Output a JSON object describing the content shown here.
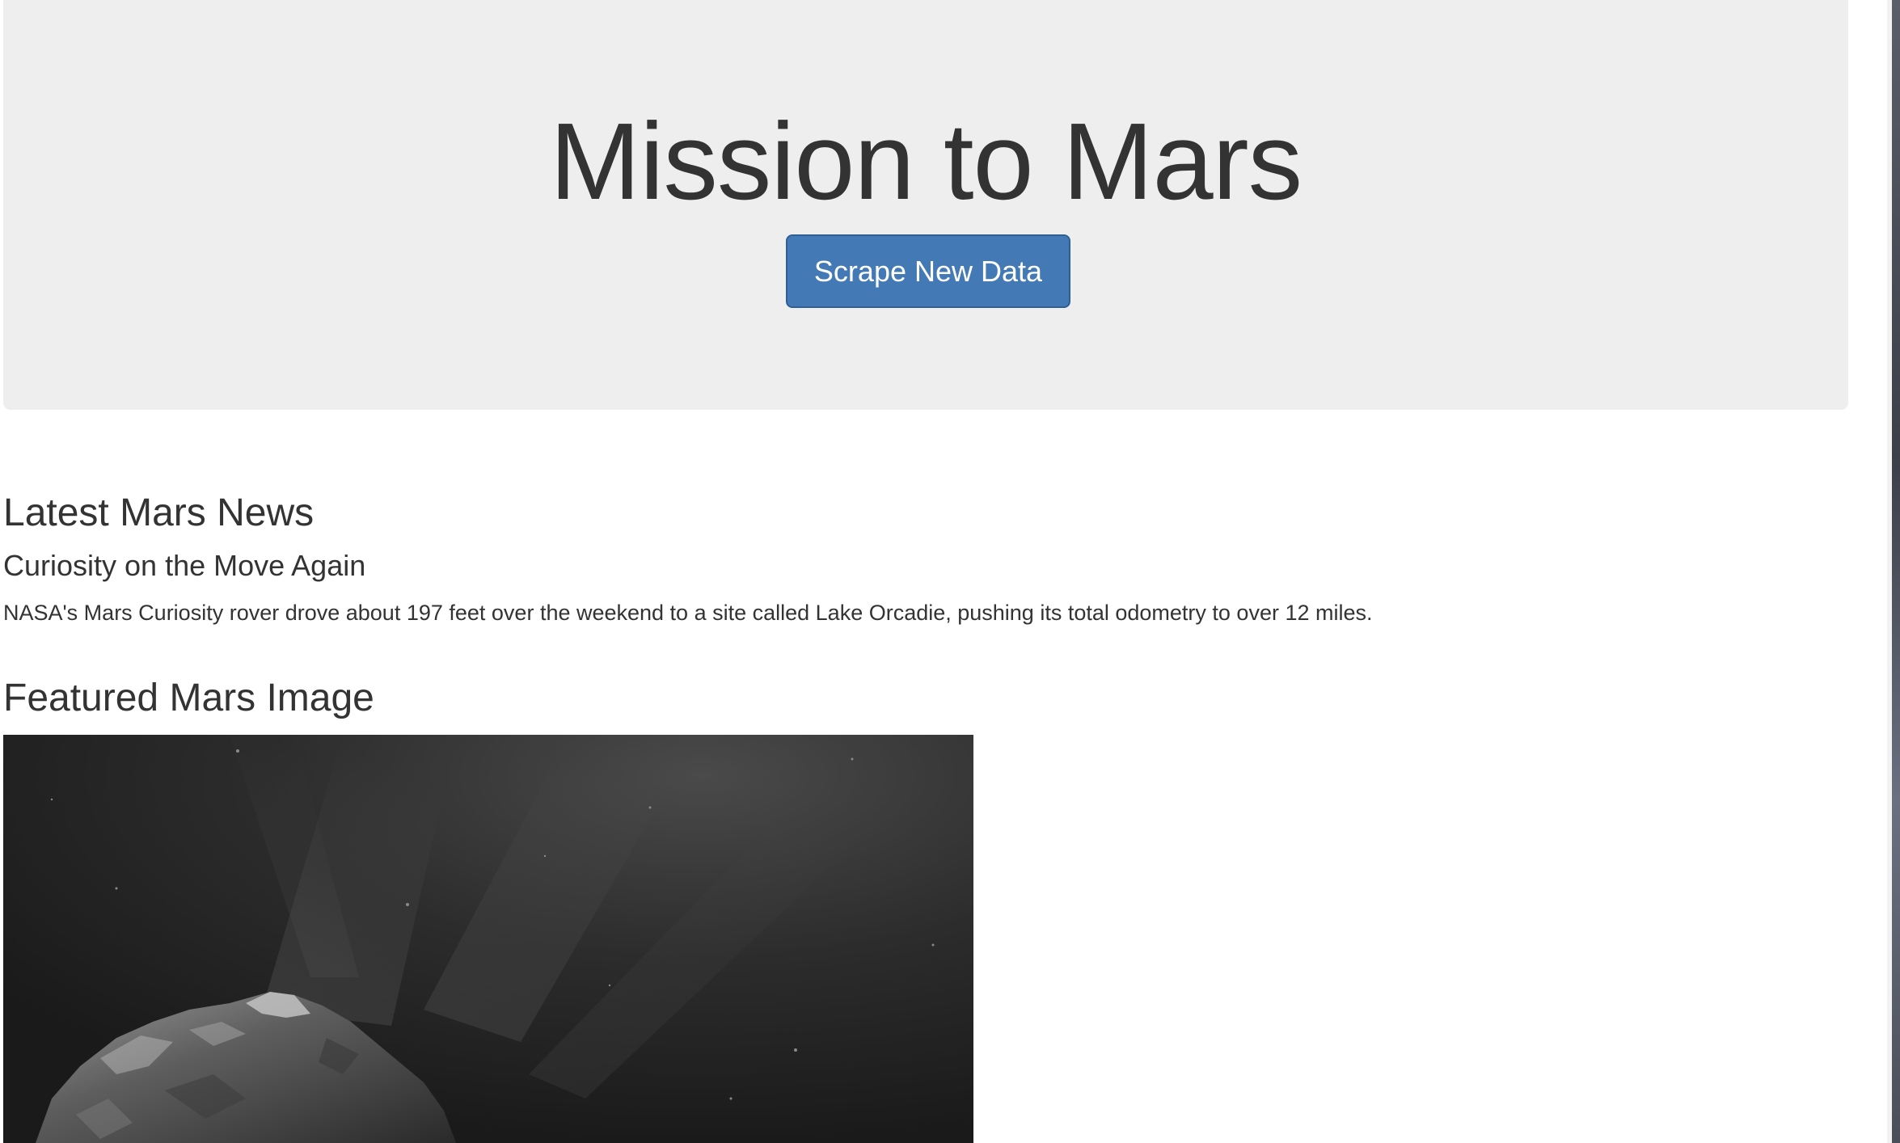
{
  "jumbotron": {
    "title": "Mission to Mars",
    "button_label": "Scrape New Data"
  },
  "news": {
    "section_title": "Latest Mars News",
    "headline": "Curiosity on the Move Again",
    "paragraph": "NASA's Mars Curiosity rover drove about 197 feet over the weekend to a site called Lake Orcadie, pushing its total odometry to over 12 miles."
  },
  "featured_image": {
    "section_title": "Featured Mars Image"
  },
  "colors": {
    "jumbotron_bg": "#eeeeee",
    "button_primary": "#437ab5",
    "text": "#333333"
  }
}
